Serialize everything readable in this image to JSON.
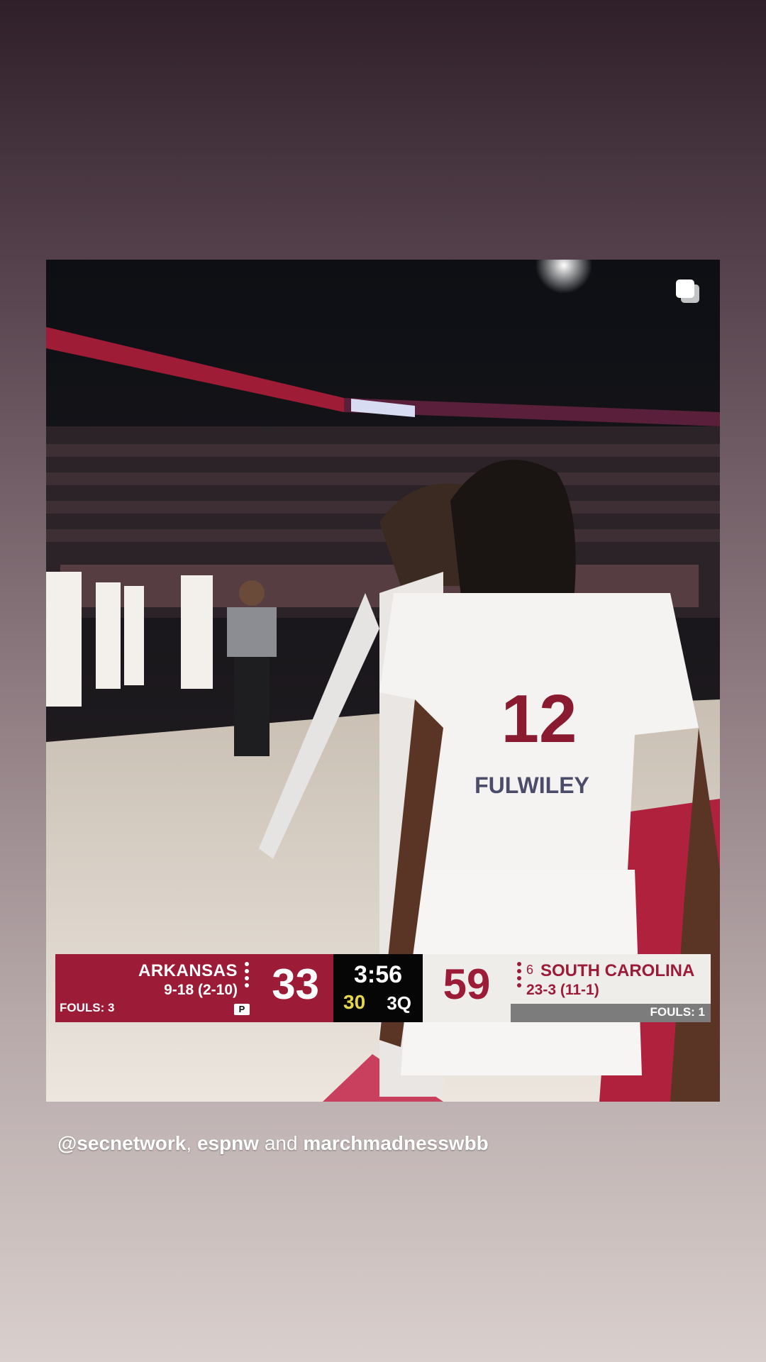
{
  "scoreboard": {
    "away_team": "ARKANSAS",
    "away_record": "9-18 (2-10)",
    "away_fouls": "FOULS: 3",
    "away_score": "33",
    "possession_indicator": "P",
    "clock": "3:56",
    "shot_clock": "30",
    "quarter": "3Q",
    "home_score": "59",
    "home_rank": "6",
    "home_team": "SOUTH CAROLINA",
    "home_record": "23-3 (11-1)",
    "home_fouls": "FOULS: 1"
  },
  "jersey": {
    "number": "12",
    "name": "FULWILEY"
  },
  "caption": {
    "mention_1": "@secnetwork",
    "separator_1": ",",
    "mention_2": "espnw",
    "separator_2": "and",
    "mention_3": "marchmadnesswbb"
  },
  "icons": {
    "multi_post": "multiple-images-icon"
  },
  "colors": {
    "arkansas_red": "#9c1b37",
    "gamecock_garnet": "#9c1b37",
    "shot_clock_yellow": "#e7d54a"
  }
}
